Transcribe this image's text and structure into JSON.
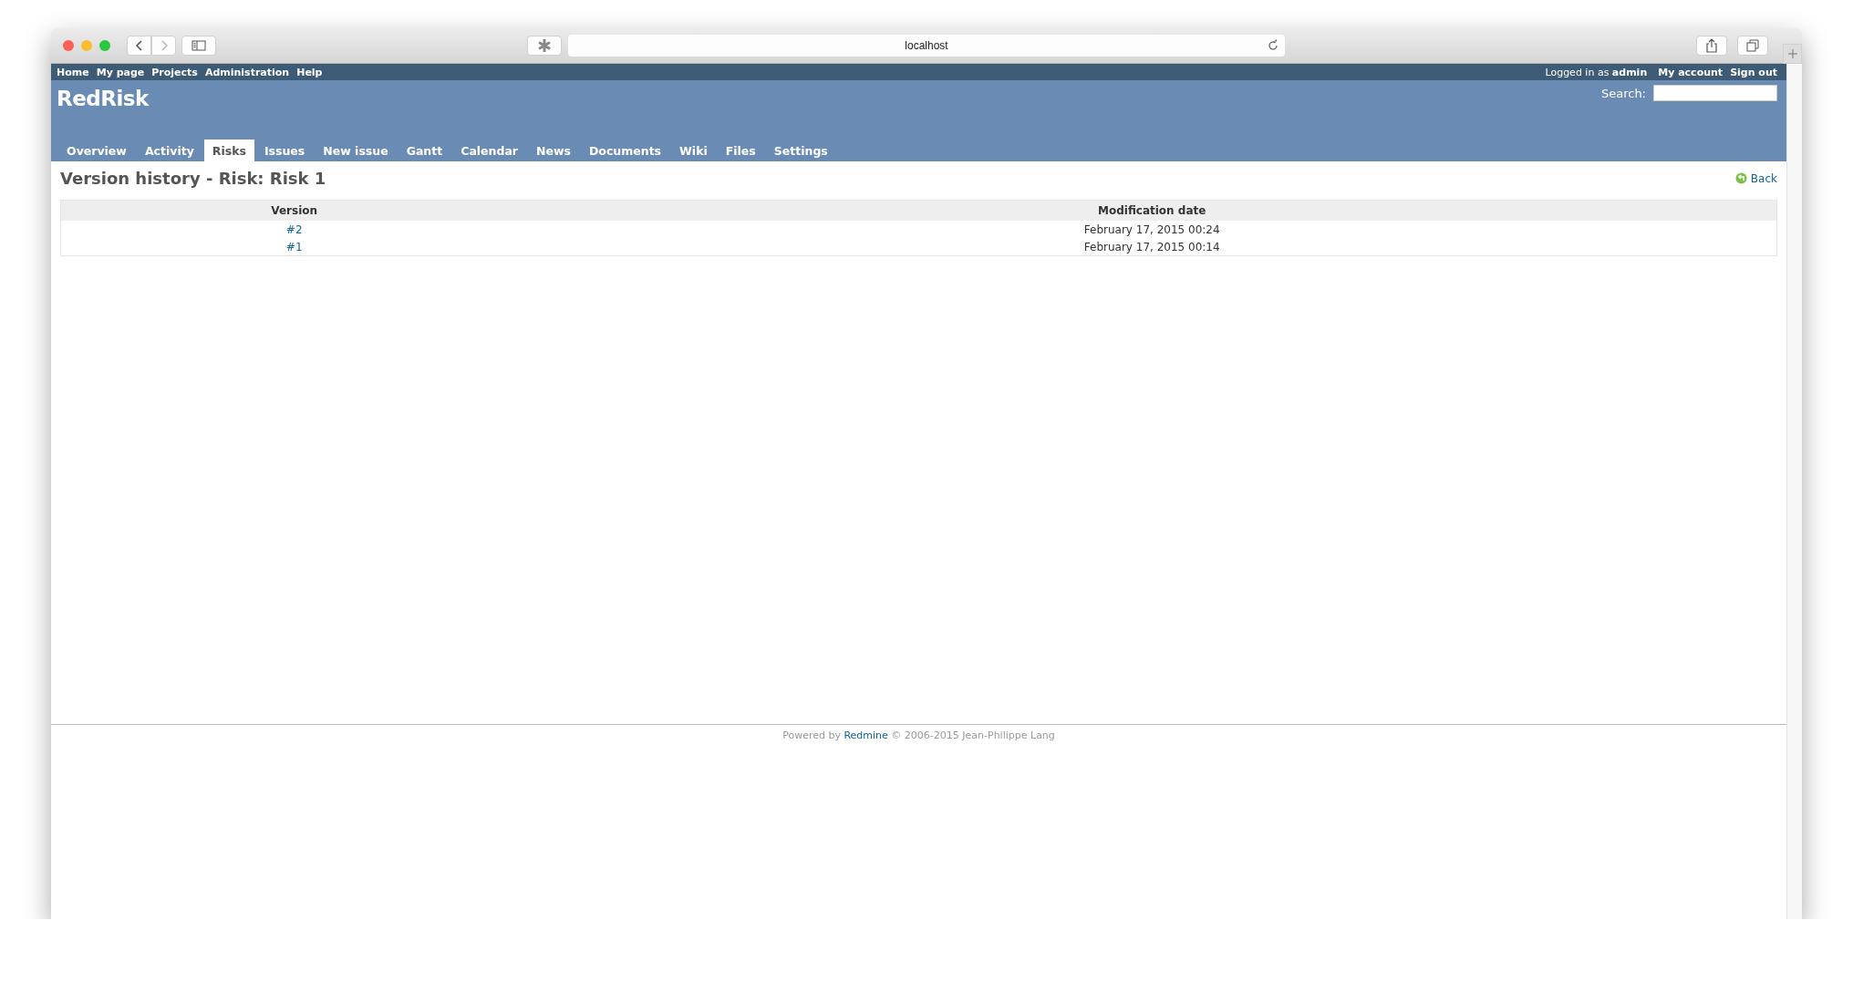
{
  "browser": {
    "address": "localhost"
  },
  "top_menu": {
    "items": [
      "Home",
      "My page",
      "Projects",
      "Administration",
      "Help"
    ],
    "logged_in": "Logged in as **admin**",
    "account_links": [
      "My account",
      "Sign out"
    ]
  },
  "header": {
    "title": "RedRisk",
    "search": {
      "label": "Search:"
    }
  },
  "tabs": [
    {
      "label": "Overview",
      "selected": false
    },
    {
      "label": "Activity",
      "selected": false
    },
    {
      "label": "Risks",
      "selected": true
    },
    {
      "label": "Issues",
      "selected": false
    },
    {
      "label": "New issue",
      "selected": false
    },
    {
      "label": "Gantt",
      "selected": false
    },
    {
      "label": "Calendar",
      "selected": false
    },
    {
      "label": "News",
      "selected": false
    },
    {
      "label": "Documents",
      "selected": false
    },
    {
      "label": "Wiki",
      "selected": false
    },
    {
      "label": "Files",
      "selected": false
    },
    {
      "label": "Settings",
      "selected": false
    }
  ],
  "content": {
    "title": "Version history - Risk: Risk 1",
    "back_link": "Back",
    "table": {
      "columns": [
        "Version",
        "Modification date"
      ],
      "rows": [
        {
          "version": "#2",
          "date": "February 17, 2015 00:24"
        },
        {
          "version": "#1",
          "date": "February 17, 2015 00:14"
        }
      ]
    }
  },
  "footer": {
    "prefix": "Powered by",
    "link": "Redmine",
    "suffix": "© 2006-2015 Jean-Philippe Lang"
  }
}
